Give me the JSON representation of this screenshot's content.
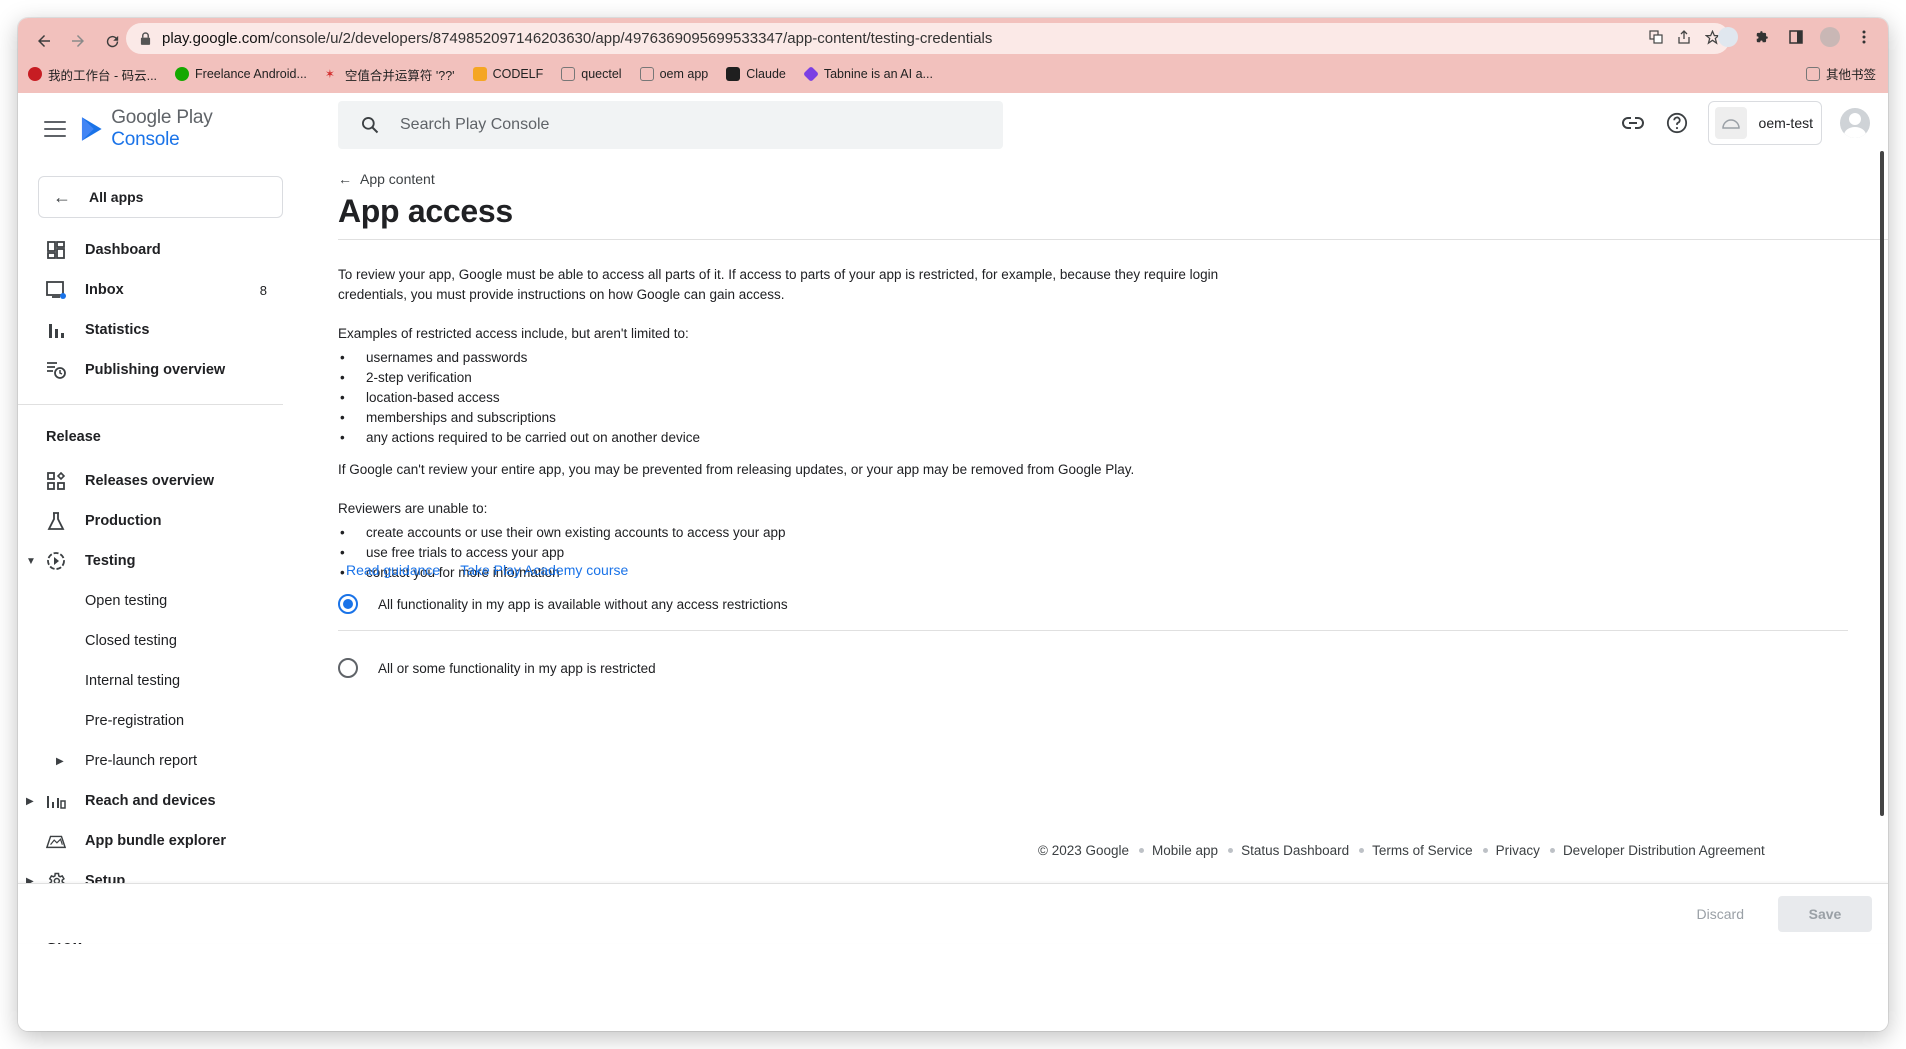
{
  "browser": {
    "url_host": "play.google.com",
    "url_path": "/console/u/2/developers/8749852097146203630/app/4976369095699533347/app-content/testing-credentials",
    "bookmarks": [
      {
        "label": "我的工作台 - 码云...",
        "color": "#c71d23"
      },
      {
        "label": "Freelance Android...",
        "color": "#14a800"
      },
      {
        "label": "空值合并运算符 '??'",
        "color": "#d32f2f"
      },
      {
        "label": "CODELF",
        "color": "#f5a623"
      },
      {
        "label": "quectel",
        "color": "#888888"
      },
      {
        "label": "oem app",
        "color": "#888888"
      },
      {
        "label": "Claude",
        "color": "#cc785c"
      },
      {
        "label": "Tabnine is an AI a...",
        "color": "#7b3fe4"
      }
    ],
    "other_bookmarks": "其他书签"
  },
  "brand": {
    "part1": "Google Play ",
    "part2": "Console"
  },
  "sidebar": {
    "all_apps": "All apps",
    "top_items": [
      {
        "label": "Dashboard",
        "icon": "dashboard-icon"
      },
      {
        "label": "Inbox",
        "icon": "inbox-icon",
        "count": "8"
      },
      {
        "label": "Statistics",
        "icon": "statistics-icon"
      },
      {
        "label": "Publishing overview",
        "icon": "publishing-icon"
      }
    ],
    "release_label": "Release",
    "release_items": [
      {
        "label": "Releases overview"
      },
      {
        "label": "Production"
      },
      {
        "label": "Testing"
      },
      {
        "label": "Open testing"
      },
      {
        "label": "Closed testing"
      },
      {
        "label": "Internal testing"
      },
      {
        "label": "Pre-registration"
      },
      {
        "label": "Pre-launch report"
      },
      {
        "label": "Reach and devices"
      },
      {
        "label": "App bundle explorer"
      },
      {
        "label": "Setup"
      }
    ],
    "grow_label": "Grow"
  },
  "search": {
    "placeholder": "Search Play Console"
  },
  "account": {
    "developer_name": "oem-test"
  },
  "main": {
    "back_label": "App content",
    "title": "App access",
    "intro": "To review your app, Google must be able to access all parts of it. If access to parts of your app is restricted, for example, because they require login credentials, you must provide instructions on how Google can gain access.",
    "examples_heading": "Examples of restricted access include, but aren't limited to:",
    "examples": [
      "usernames and passwords",
      "2-step verification",
      "location-based access",
      "memberships and subscriptions",
      "any actions required to be carried out on another device"
    ],
    "warning": "If Google can't review your entire app, you may be prevented from releasing updates, or your app may be removed from Google Play.",
    "reviewers_heading": "Reviewers are unable to:",
    "reviewers_items": [
      "create accounts or use their own existing accounts to access your app",
      "use free trials to access your app",
      "contact you for more information"
    ],
    "link_guidance": "Read guidance",
    "link_academy": "Take Play Academy course",
    "option_all": "All functionality in my app is available without any access restrictions",
    "option_restricted": "All or some functionality in my app is restricted",
    "selected_option": "all"
  },
  "footer": {
    "copyright": "© 2023 Google",
    "links": [
      "Mobile app",
      "Status Dashboard",
      "Terms of Service",
      "Privacy",
      "Developer Distribution Agreement"
    ]
  },
  "actions": {
    "discard": "Discard",
    "save": "Save"
  },
  "colors": {
    "accent": "#1a73e8",
    "chrome_bar": "#f2c1bd"
  }
}
